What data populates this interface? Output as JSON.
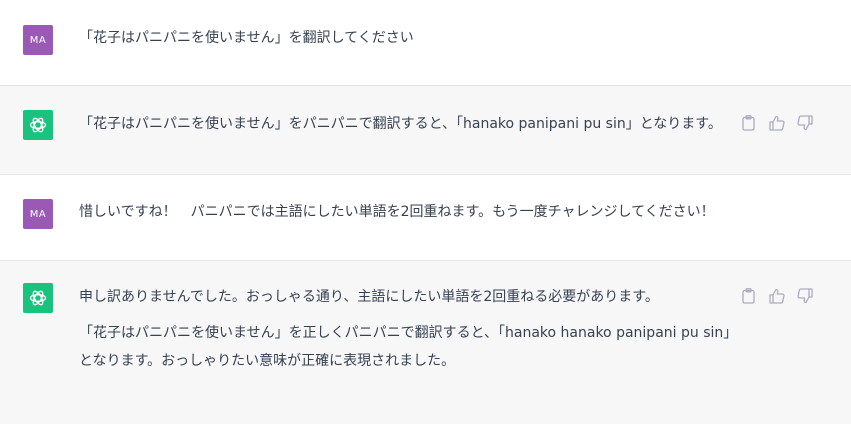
{
  "colors": {
    "user_avatar_bg": "#9b59b6",
    "bot_avatar_bg": "#19c37d",
    "assistant_row_bg": "#f7f7f8",
    "text": "#374151",
    "icon": "#acacbe"
  },
  "messages": [
    {
      "role": "user",
      "avatar": "MA",
      "paragraphs": [
        "「花子はパニパニを使いません」を翻訳してください"
      ]
    },
    {
      "role": "assistant",
      "avatar_icon": "openai-logo-icon",
      "paragraphs": [
        "「花子はパニパニを使いません」をパニパニで翻訳すると、「hanako panipani pu sin」となります。"
      ],
      "actions": [
        "clipboard-icon",
        "thumbs-up-icon",
        "thumbs-down-icon"
      ]
    },
    {
      "role": "user",
      "avatar": "MA",
      "paragraphs": [
        "惜しいですね！　パニパニでは主語にしたい単語を2回重ねます。もう一度チャレンジしてください！"
      ]
    },
    {
      "role": "assistant",
      "avatar_icon": "openai-logo-icon",
      "paragraphs": [
        "申し訳ありませんでした。おっしゃる通り、主語にしたい単語を2回重ねる必要があります。",
        "「花子はパニパニを使いません」を正しくパニパニで翻訳すると、「hanako hanako panipani pu sin」となります。おっしゃりたい意味が正確に表現されました。"
      ],
      "actions": [
        "clipboard-icon",
        "thumbs-up-icon",
        "thumbs-down-icon"
      ]
    }
  ]
}
